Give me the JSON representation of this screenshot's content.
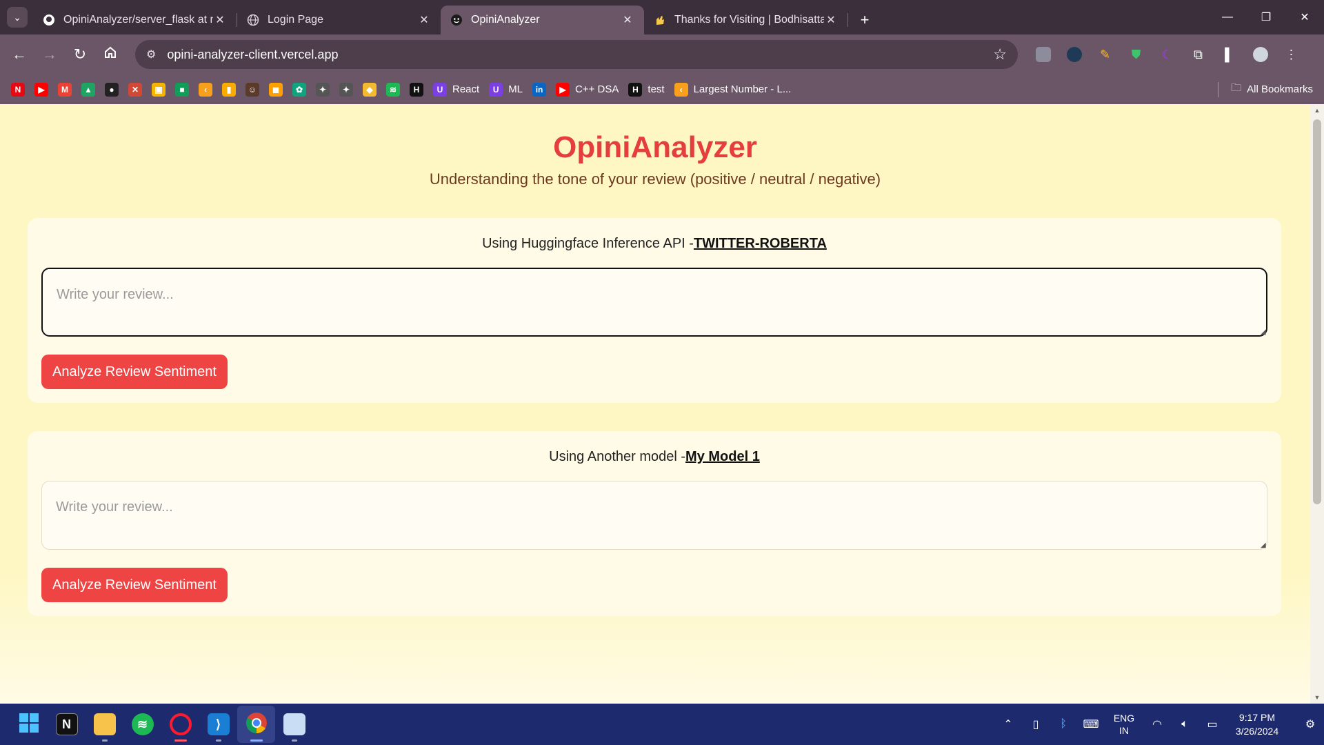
{
  "tabs": [
    {
      "title": "OpiniAnalyzer/server_flask at m",
      "icon": "github-icon",
      "active": false
    },
    {
      "title": "Login Page",
      "icon": "globe-icon",
      "active": false
    },
    {
      "title": "OpiniAnalyzer",
      "icon": "smiley-icon",
      "active": true
    },
    {
      "title": "Thanks for Visiting | Bodhisatta",
      "icon": "hand-icon",
      "active": false
    }
  ],
  "toolbar": {
    "url": "opini-analyzer-client.vercel.app"
  },
  "bookmarks": [
    {
      "label": "",
      "icon": "netflix-icon",
      "color": "#e50914",
      "glyph": "N"
    },
    {
      "label": "",
      "icon": "youtube-icon",
      "color": "#ff0000",
      "glyph": "▶"
    },
    {
      "label": "",
      "icon": "gmail-icon",
      "color": "#ea4335",
      "glyph": "M"
    },
    {
      "label": "",
      "icon": "drive-icon",
      "color": "#1fa463",
      "glyph": "▲"
    },
    {
      "label": "",
      "icon": "github-icon",
      "color": "#222222",
      "glyph": "●"
    },
    {
      "label": "",
      "icon": "x-icon",
      "color": "#d14836",
      "glyph": "✕"
    },
    {
      "label": "",
      "icon": "photos-icon",
      "color": "#f4b400",
      "glyph": "▣"
    },
    {
      "label": "",
      "icon": "classroom-icon",
      "color": "#0f9d58",
      "glyph": "■"
    },
    {
      "label": "",
      "icon": "leetcode-icon",
      "color": "#f89f1b",
      "glyph": "‹"
    },
    {
      "label": "",
      "icon": "analytics-icon",
      "color": "#f9ab00",
      "glyph": "▮"
    },
    {
      "label": "",
      "icon": "avatar-bookmark-icon",
      "color": "#5a3a2a",
      "glyph": "☺"
    },
    {
      "label": "",
      "icon": "codechef-icon",
      "color": "#ffa000",
      "glyph": "◼"
    },
    {
      "label": "",
      "icon": "chatgpt-icon",
      "color": "#10a37f",
      "glyph": "✿"
    },
    {
      "label": "",
      "icon": "unity-icon",
      "color": "#555555",
      "glyph": "✦"
    },
    {
      "label": "",
      "icon": "unity-icon-2",
      "color": "#555555",
      "glyph": "✦"
    },
    {
      "label": "",
      "icon": "binance-icon",
      "color": "#f3ba2f",
      "glyph": "◆"
    },
    {
      "label": "",
      "icon": "spotify-icon",
      "color": "#1db954",
      "glyph": "≋"
    },
    {
      "label": "",
      "icon": "hackerrank-icon",
      "color": "#111111",
      "glyph": "H"
    },
    {
      "label": "React",
      "icon": "udemy-icon",
      "color": "#7b3fe4",
      "glyph": "U"
    },
    {
      "label": "ML",
      "icon": "udemy-icon",
      "color": "#7b3fe4",
      "glyph": "U"
    },
    {
      "label": "",
      "icon": "linkedin-icon",
      "color": "#0a66c2",
      "glyph": "in"
    },
    {
      "label": "C++ DSA",
      "icon": "youtube-icon",
      "color": "#ff0000",
      "glyph": "▶"
    },
    {
      "label": "test",
      "icon": "hackerrank-icon",
      "color": "#111111",
      "glyph": "H"
    },
    {
      "label": "Largest Number - L...",
      "icon": "leetcode-icon",
      "color": "#f89f1b",
      "glyph": "‹"
    }
  ],
  "all_bookmarks_label": "All Bookmarks",
  "page": {
    "title": "OpiniAnalyzer",
    "subtitle": "Understanding the tone of your review (positive / neutral / negative)",
    "colors": {
      "title": "#e53e3e",
      "button": "#ee4444",
      "background": "#fef7c3",
      "card": "#fffbe6"
    },
    "cards": [
      {
        "prefix": "Using Huggingface Inference API -",
        "model": "TWITTER-ROBERTA",
        "placeholder": "Write your review...",
        "button": "Analyze Review Sentiment",
        "focused": true
      },
      {
        "prefix": "Using Another model -",
        "model": "My Model 1",
        "placeholder": "Write your review...",
        "button": "Analyze Review Sentiment",
        "focused": false
      }
    ]
  },
  "taskbar": {
    "apps": [
      "windows-start-icon",
      "notion-icon",
      "file-explorer-icon",
      "spotify-icon",
      "opera-icon",
      "vscode-icon",
      "chrome-icon",
      "photos-app-icon"
    ],
    "lang_top": "ENG",
    "lang_bottom": "IN",
    "time": "9:17 PM",
    "date": "3/26/2024"
  }
}
